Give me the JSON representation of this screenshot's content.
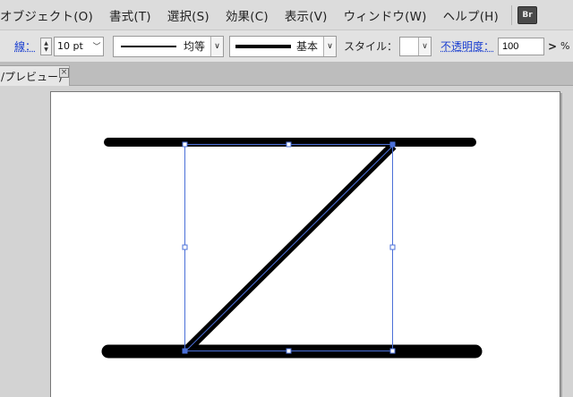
{
  "menu": {
    "items": [
      {
        "label": "オブジェクト(O)"
      },
      {
        "label": "書式(T)"
      },
      {
        "label": "選択(S)"
      },
      {
        "label": "効果(C)"
      },
      {
        "label": "表示(V)"
      },
      {
        "label": "ウィンドウ(W)"
      },
      {
        "label": "ヘルプ(H)"
      }
    ],
    "bridge_badge": "Br"
  },
  "control": {
    "stroke_label": "線：",
    "stroke_weight": "10 pt",
    "profile_label": "均等",
    "brush_label": "基本",
    "style_label": "スタイル：",
    "opacity_label": "不透明度：",
    "opacity_value": "100",
    "opacity_unit": "%"
  },
  "tab": {
    "label": "/プレビュー)",
    "close_glyph": "×"
  },
  "icons": {
    "stepper": "stepper-icon",
    "dropdown": "chevron-down-icon",
    "flyout": "chevron-right-icon",
    "close": "close-icon"
  },
  "colors": {
    "selection": "#4a6fd8",
    "link_label": "#1a3fd0",
    "stroke": "#000000"
  }
}
